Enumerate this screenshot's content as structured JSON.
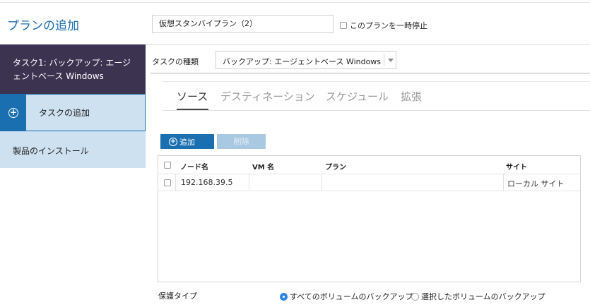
{
  "header": {
    "page_title": "プランの追加",
    "plan_name_value": "仮想スタンバイプラン（2）",
    "pause_label": "このプランを一時停止",
    "pause_checked": false
  },
  "sidebar": {
    "task_item_label": "タスク1: バックアップ: エージェントベース Windows",
    "add_task_label": "タスクの追加",
    "install_label": "製品のインストール"
  },
  "task_type": {
    "label": "タスクの種類",
    "selected": "バックアップ: エージェントベース Windows"
  },
  "tabs": [
    {
      "label": "ソース",
      "active": true
    },
    {
      "label": "デスティネーション",
      "active": false
    },
    {
      "label": "スケジュール",
      "active": false
    },
    {
      "label": "拡張",
      "active": false
    }
  ],
  "toolbar": {
    "add_label": "追加",
    "delete_label": "削除"
  },
  "table": {
    "columns": [
      "ノード名",
      "VM 名",
      "プラン",
      "サイト"
    ],
    "rows": [
      {
        "node": "192.168.39.5",
        "vm": "",
        "plan": "",
        "site": "ローカル サイト"
      }
    ]
  },
  "protection": {
    "label": "保護タイプ",
    "options": [
      {
        "label": "すべてのボリュームのバックアップ",
        "selected": true
      },
      {
        "label": "選択したボリュームのバックアップ",
        "selected": false
      }
    ]
  },
  "colors": {
    "accent": "#1a6fb0",
    "sidebar_active": "#3c3351",
    "sidebar_light": "#cde1f1"
  }
}
